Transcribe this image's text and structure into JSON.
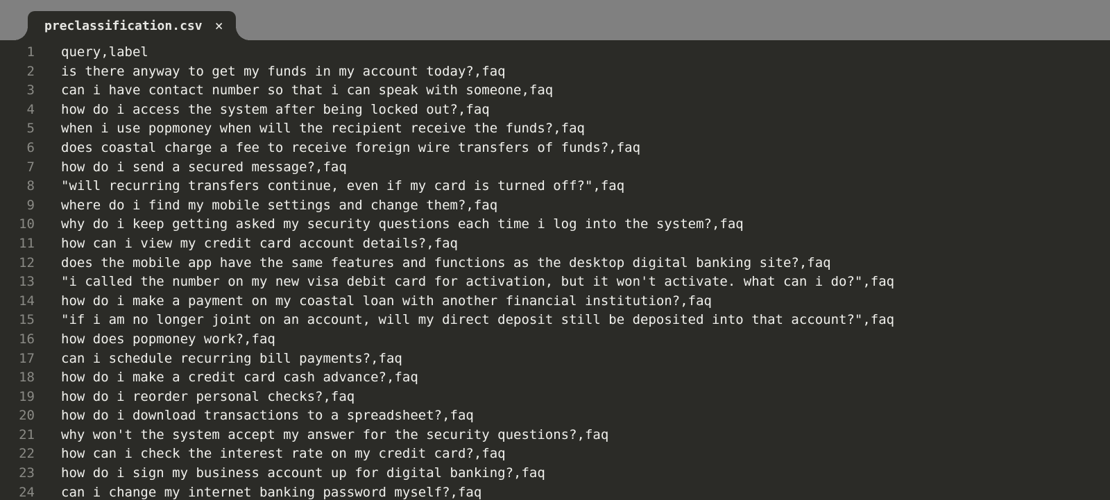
{
  "tab": {
    "filename": "preclassification.csv",
    "close_glyph": "×"
  },
  "editor": {
    "lines": [
      "query,label",
      "is there anyway to get my funds in my account today?,faq",
      "can i have contact number so that i can speak with someone,faq",
      "how do i access the system after being locked out?,faq",
      "when i use popmoney when will the recipient receive the funds?,faq",
      "does coastal charge a fee to receive foreign wire transfers of funds?,faq",
      "how do i send a secured message?,faq",
      "\"will recurring transfers continue, even if my card is turned off?\",faq",
      "where do i find my mobile settings and change them?,faq",
      "why do i keep getting asked my security questions each time i log into the system?,faq",
      "how can i view my credit card account details?,faq",
      "does the mobile app have the same features and functions as the desktop digital banking site?,faq",
      "\"i called the number on my new visa debit card for activation, but it won't activate. what can i do?\",faq",
      "how do i make a payment on my coastal loan with another financial institution?,faq",
      "\"if i am no longer joint on an account, will my direct deposit still be deposited into that account?\",faq",
      "how does popmoney work?,faq",
      "can i schedule recurring bill payments?,faq",
      "how do i make a credit card cash advance?,faq",
      "how do i reorder personal checks?,faq",
      "how do i download transactions to a spreadsheet?,faq",
      "why won't the system accept my answer for the security questions?,faq",
      "how can i check the interest rate on my credit card?,faq",
      "how do i sign my business account up for digital banking?,faq",
      "can i change my internet banking password myself?,faq"
    ]
  }
}
